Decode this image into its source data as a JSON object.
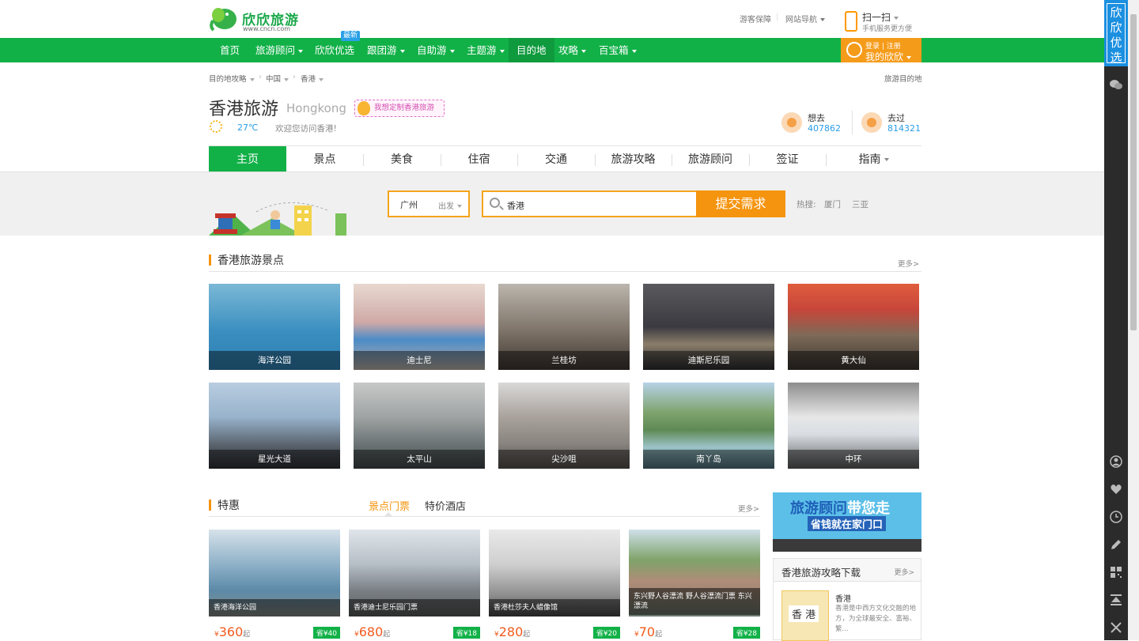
{
  "header": {
    "brand": "欣欣旅游",
    "url": "www.cncn.com",
    "links": [
      "游客保障",
      "网站导航"
    ],
    "scan_title": "扫一扫",
    "scan_sub": "手机服务更方便"
  },
  "nav": {
    "items": [
      "首页",
      "旅游顾问",
      "欣欣优选",
      "跟团游",
      "自助游",
      "主题游",
      "目的地",
      "攻略",
      "百宝箱"
    ],
    "badge": "最新",
    "login_top": "登录 | 注册",
    "login_bottom": "我的欣欣"
  },
  "breadcrumb": {
    "items": [
      "目的地攻略",
      "中国",
      "香港"
    ],
    "right": "旅游目的地"
  },
  "destination": {
    "title": "香港旅游",
    "title_en": "Hongkong",
    "custom_link": "我想定制香港旅游",
    "temperature": "27℃",
    "welcome": "欢迎您访问香港!",
    "want_label": "想去",
    "want_count": "407862",
    "been_label": "去过",
    "been_count": "814321"
  },
  "tabs": [
    "主页",
    "景点",
    "美食",
    "住宿",
    "交通",
    "旅游攻略",
    "旅游顾问",
    "签证",
    "指南"
  ],
  "search": {
    "city": "广州",
    "depart": "出发",
    "query": "香港",
    "button": "提交需求",
    "hot_label": "热搜:",
    "hot": [
      "厦门",
      "三亚"
    ]
  },
  "spots": {
    "title": "香港旅游景点",
    "more": "更多>",
    "items": [
      "海洋公园",
      "迪士尼",
      "兰桂坊",
      "迪斯尼乐园",
      "黄大仙",
      "星光大道",
      "太平山",
      "尖沙咀",
      "南丫岛",
      "中环"
    ]
  },
  "deals": {
    "title": "特惠",
    "tab_active": "景点门票",
    "tab_other": "特价酒店",
    "more": "更多>",
    "items": [
      {
        "name": "香港海洋公园",
        "price": "360",
        "save": "省¥40"
      },
      {
        "name": "香港迪士尼乐园门票",
        "price": "680",
        "save": "省¥18"
      },
      {
        "name": "香港杜莎夫人蜡像馆",
        "price": "280",
        "save": "省¥20"
      },
      {
        "name": "东兴野人谷漂流 野人谷漂流门票 东兴漂流",
        "price": "70",
        "save": "省¥28"
      }
    ],
    "currency": "¥",
    "unit": "起"
  },
  "ad": {
    "line1a": "旅游顾问",
    "line1b": "带您走",
    "line2": "省钱就在家门口"
  },
  "guide": {
    "title": "香港旅游攻略下载",
    "more": "更多>",
    "cover": "香 港",
    "name": "香港",
    "desc": "香港是中西方文化交融的地方，为全球最安全、富裕、繁..."
  },
  "sidebar": {
    "top": "欣欣优选"
  }
}
